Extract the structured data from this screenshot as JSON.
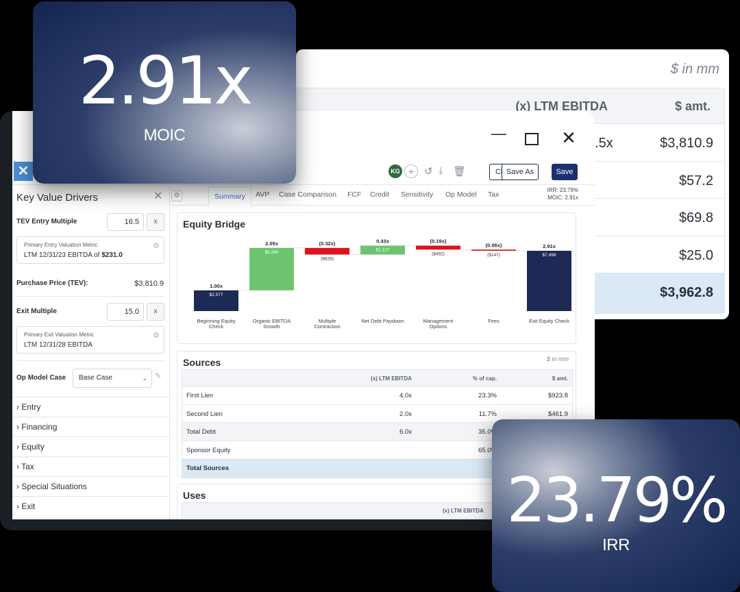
{
  "moic_card": {
    "value": "2.91x",
    "label": "MOIC"
  },
  "irr_card": {
    "value": "23.79%",
    "label": "IRR"
  },
  "background_table": {
    "units": "$ in mm",
    "headers": [
      "(x) LTM EBITDA",
      "$ amt."
    ],
    "rows": [
      {
        "multiple": "6.5x",
        "amount": "$3,810.9"
      },
      {
        "multiple": "",
        "amount": "$57.2"
      },
      {
        "multiple": "",
        "amount": "$69.8"
      },
      {
        "multiple": "",
        "amount": "$25.0"
      },
      {
        "multiple": "",
        "amount": "$3,962.8"
      }
    ]
  },
  "window": {
    "controls": {
      "minimize": "—",
      "close": "✕"
    }
  },
  "toolbar": {
    "avatar": "KG",
    "add": "+",
    "close_label": "Close",
    "saveas_label": "Save As",
    "save_label": "Save"
  },
  "sidebar": {
    "title": "Key Value Drivers",
    "tev_label": "TEV Entry Multiple",
    "tev_value": "16.5",
    "x_label": "x",
    "entry_metric_small": "Primary Entry Valuation Metric",
    "entry_metric_prefix": "LTM 12/31/23 EBITDA of",
    "entry_metric_value": "$231.0",
    "purchase_label": "Purchase Price (TEV):",
    "purchase_value": "$3,810.9",
    "exit_label": "Exit Multiple",
    "exit_value": "15.0",
    "exit_metric_small": "Primary Exit Valuation Metric",
    "exit_metric_value": "LTM 12/31/28 EBITDA",
    "op_model_label": "Op Model Case",
    "op_model_value": "Base Case",
    "sections": [
      "Entry",
      "Financing",
      "Equity",
      "Tax",
      "Special Situations",
      "Exit"
    ]
  },
  "tabs": {
    "items": [
      "Summary",
      "AVP",
      "Case Comparison",
      "FCF",
      "Credit",
      "Sensitivity",
      "Op Model",
      "Tax"
    ],
    "active": "Summary",
    "irr_mini": "IRR: 23.79%",
    "moic_mini": "MOIC:    2.91x"
  },
  "equity_bridge": {
    "title": "Equity Bridge"
  },
  "chart_data": {
    "type": "bar",
    "subtype": "waterfall",
    "title": "Equity Bridge",
    "categories": [
      "Beginning Equity Check",
      "Organic EBITDA Growth",
      "Multiple Contraction",
      "Net Debt Paydown",
      "Management Options",
      "Fees",
      "Exit Equity Check"
    ],
    "values": [
      2577,
      5280,
      -826,
      1107,
      -492,
      -147,
      7498
    ],
    "value_labels": [
      "$2,577",
      "$5,280",
      "($826)",
      "$1,107",
      "($492)",
      "($147)",
      "$7,498"
    ],
    "multiple_labels": [
      "1.00x",
      "2.05x",
      "(0.32x)",
      "0.43x",
      "(0.19x)",
      "(0.06x)",
      "2.91x"
    ],
    "colors": {
      "total": "#1c2a55",
      "positive": "#6cc46f",
      "negative": "#d9141c"
    }
  },
  "sources": {
    "title": "Sources",
    "units": "$ in mm",
    "headers": [
      "(x) LTM EBITDA",
      "% of cap.",
      "$ amt."
    ],
    "rows": [
      {
        "name": "First Lien",
        "multiple": "4.0x",
        "pct": "23.3%",
        "amount": "$923.8",
        "style": ""
      },
      {
        "name": "Second Lien",
        "multiple": "2.0x",
        "pct": "11.7%",
        "amount": "$461.9",
        "style": ""
      },
      {
        "name": "Total Debt",
        "multiple": "6.0x",
        "pct": "35.0%",
        "amount": "",
        "style": "sub"
      },
      {
        "name": "Sponsor Equity",
        "multiple": "",
        "pct": "65.0%",
        "amount": "",
        "style": ""
      },
      {
        "name": "Total Sources",
        "multiple": "",
        "pct": "",
        "amount": "",
        "style": "total"
      }
    ]
  },
  "uses": {
    "title": "Uses",
    "header": "(x) LTM EBITDA"
  }
}
